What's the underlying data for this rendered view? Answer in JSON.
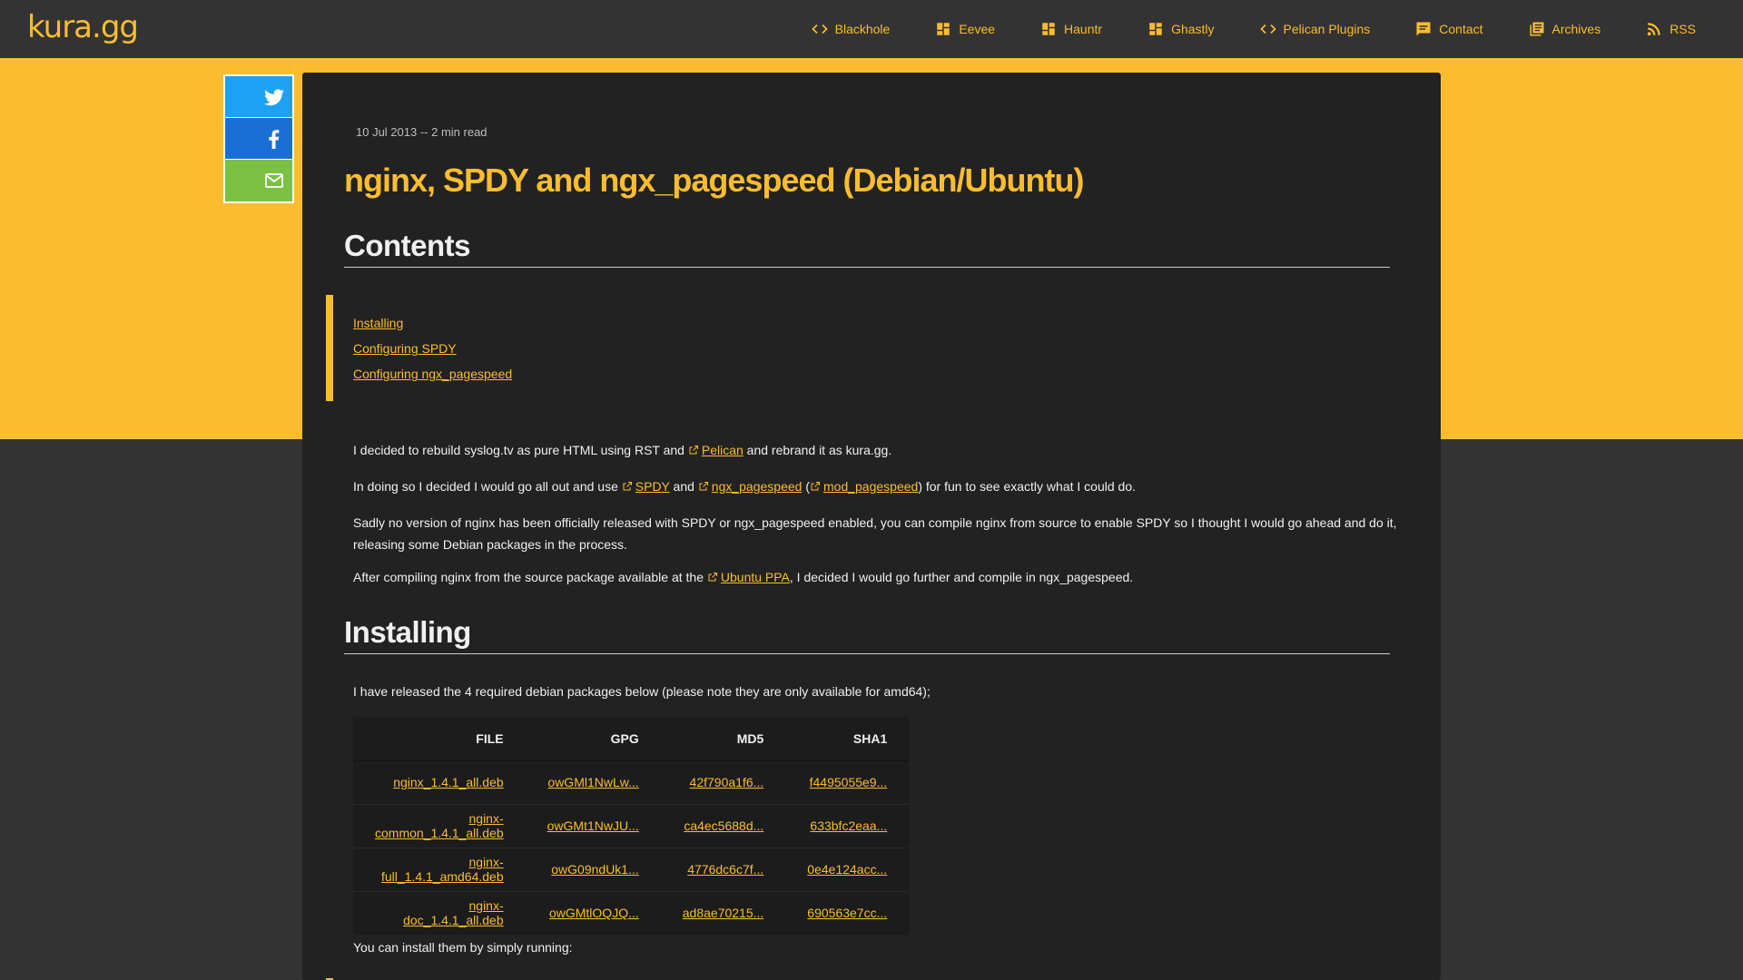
{
  "site": {
    "brand": "kura.gg"
  },
  "nav": [
    {
      "label": "Blackhole",
      "icon": "code-icon"
    },
    {
      "label": "Eevee",
      "icon": "dashboard-icon"
    },
    {
      "label": "Hauntr",
      "icon": "dashboard-icon"
    },
    {
      "label": "Ghastly",
      "icon": "dashboard-icon"
    },
    {
      "label": "Pelican Plugins",
      "icon": "code-icon"
    },
    {
      "label": "Contact",
      "icon": "chat-icon"
    },
    {
      "label": "Archives",
      "icon": "library-icon"
    },
    {
      "label": "RSS",
      "icon": "rss-icon"
    }
  ],
  "share": {
    "twitter_icon": "twitter-icon",
    "facebook_icon": "facebook-icon",
    "email_icon": "mail-icon"
  },
  "article": {
    "meta": "10 Jul 2013 -- 2 min read",
    "title": "nginx, SPDY and ngx_pagespeed (Debian/Ubuntu)",
    "contents_heading": "Contents",
    "toc": [
      "Installing",
      "Configuring SPDY",
      "Configuring ngx_pagespeed"
    ],
    "p1": {
      "before": "I decided to rebuild syslog.tv as pure HTML using RST and ",
      "link": "Pelican",
      "after": " and rebrand it as kura.gg."
    },
    "p2": {
      "before": "In doing so I decided I would go all out and use ",
      "link1": "SPDY",
      "and": " and ",
      "link2": "ngx_pagespeed",
      "paren_open": " (",
      "link3": "mod_pagespeed",
      "after": ") for fun to see exactly what I could do."
    },
    "p3": "Sadly no version of nginx has been officially released with SPDY or ngx_pagespeed enabled, you can compile nginx from source to enable SPDY so I thought I would go ahead and do it, releasing some Debian packages in the process.",
    "p4": {
      "before": "After compiling nginx from the source package available at the ",
      "link": "Ubuntu PPA",
      "after": ", I decided I would go further and compile in ngx_pagespeed."
    },
    "installing_heading": "Installing",
    "p5": "I have released the 4 required debian packages below (please note they are only available for amd64);",
    "table": {
      "headers": [
        "FILE",
        "GPG",
        "MD5",
        "SHA1"
      ],
      "rows": [
        [
          "nginx_1.4.1_all.deb",
          "owGMl1NwLw...",
          "42f790a1f6...",
          "f4495055e9..."
        ],
        [
          "nginx-common_1.4.1_all.deb",
          "owGMt1NwJU...",
          "ca4ec5688d...",
          "633bfc2eaa..."
        ],
        [
          "nginx-full_1.4.1_amd64.deb",
          "owG09ndUk1...",
          "4776dc6c7f...",
          "0e4e124acc..."
        ],
        [
          "nginx-doc_1.4.1_all.deb",
          "owGMtlOQJQ...",
          "ad8ae70215...",
          "690563e7cc..."
        ]
      ]
    },
    "p6": "You can install them by simply running:"
  },
  "colors": {
    "accent": "#fbbd2f",
    "background": "#333333",
    "card": "#222222"
  }
}
